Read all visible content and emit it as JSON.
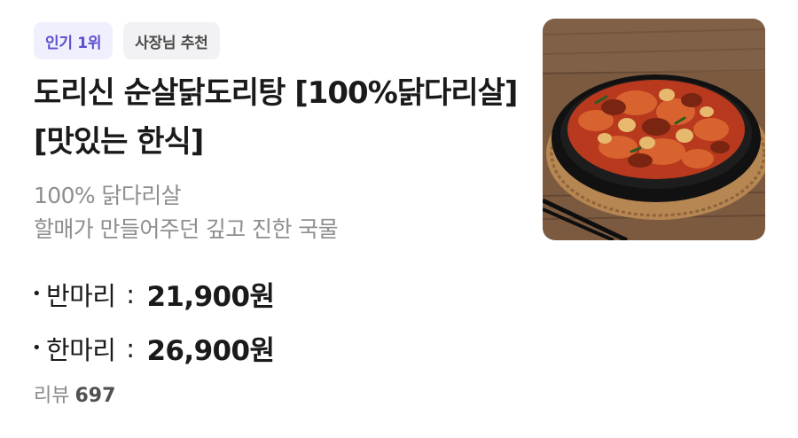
{
  "badges": {
    "popular": "인기 1위",
    "owner_pick": "사장님 추천"
  },
  "menu_item": {
    "title": "도리신 순살닭도리탕 [100%닭다리살][맛있는 한식]",
    "description_lines": [
      "100% 닭다리살",
      "할매가 만들어주던 깊고 진한 국물"
    ],
    "prices": [
      {
        "bullet": "•",
        "size": "반마리",
        "colon": ":",
        "price": "21,900원"
      },
      {
        "bullet": "•",
        "size": "한마리",
        "colon": ":",
        "price": "26,900원"
      }
    ],
    "review_label": "리뷰",
    "review_count": "697",
    "image_icon": "braised-chicken-dish-photo"
  },
  "colors": {
    "popular_badge_bg": "#f0effd",
    "popular_badge_text": "#5b4fcf",
    "owner_badge_bg": "#f2f2f4",
    "description_text": "#8e8e8e"
  }
}
